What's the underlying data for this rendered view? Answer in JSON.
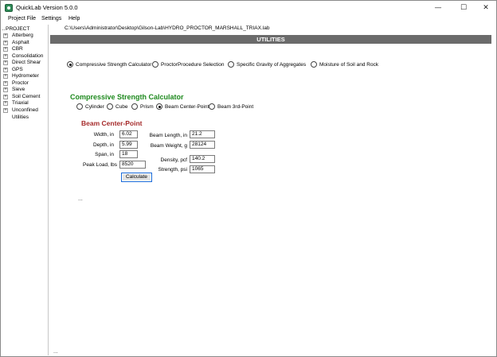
{
  "window": {
    "title": "QuickLab  Version 5.0.0",
    "min_glyph": "—",
    "max_glyph": "☐",
    "close_glyph": "✕"
  },
  "menu": [
    "Project File",
    "Settings",
    "Help"
  ],
  "sidebar": {
    "root": "PROJECT",
    "items": [
      "Atterberg",
      "Asphalt",
      "CBR",
      "Consolidation",
      "Direct Shear",
      "GPS",
      "Hydrometer",
      "Proctor",
      "Sieve",
      "Soil Cement",
      "Triaxial",
      "Unconfined"
    ],
    "plain_items": [
      "Utilities"
    ],
    "expander_glyph": "+",
    "footer_dots": "..."
  },
  "path": "C:\\Users\\Administrator\\Desktop\\Gilson-Lab\\HYDRO_PROCTOR_MARSHALL_TRIAX.lab",
  "header": {
    "title": "UTILITIES"
  },
  "utility_options": [
    {
      "label": "Compressive Strength Calculator",
      "selected": true
    },
    {
      "label": "ProctorProcedure Selection",
      "selected": false
    },
    {
      "label": "Specific Gravity of Aggregates",
      "selected": false
    },
    {
      "label": "Moisture of Soil and Rock",
      "selected": false
    }
  ],
  "calculator": {
    "title": "Compressive Strength Calculator",
    "shapes": [
      {
        "label": "Cylinder",
        "selected": false
      },
      {
        "label": "Cube",
        "selected": false
      },
      {
        "label": "Prism",
        "selected": false
      },
      {
        "label": "Beam Center-Point",
        "selected": true
      },
      {
        "label": "Beam 3rd-Point",
        "selected": false
      }
    ]
  },
  "beam": {
    "title": "Beam Center-Point",
    "width_label": "Width, in",
    "width_value": "6.02",
    "depth_label": "Depth, in",
    "depth_value": "5.99",
    "span_label": "Span, in",
    "span_value": "18",
    "peak_label": "Peak Load, lbs",
    "peak_value": "8520",
    "length_label": "Beam Length, in",
    "length_value": "21.2",
    "weight_label": "Beam Weight, g",
    "weight_value": "28124",
    "density_label": "Density, pcf",
    "density_value": "140.2",
    "strength_label": "Strength, psi",
    "strength_value": "1065",
    "calculate_label": "Calculate",
    "result_dots": "..."
  }
}
